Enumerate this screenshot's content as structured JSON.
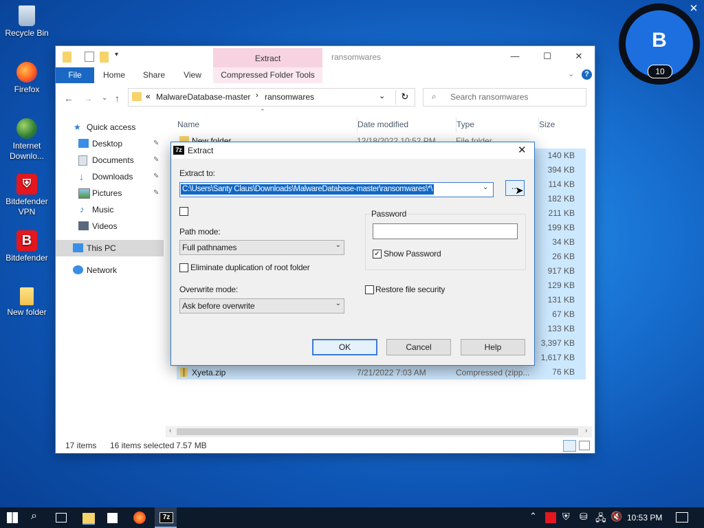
{
  "desktop": {
    "icons": [
      {
        "label": "Recycle Bin"
      },
      {
        "label": "Firefox"
      },
      {
        "label": "Internet Downlo..."
      },
      {
        "label": "Bitdefender VPN"
      },
      {
        "label": "Bitdefender"
      },
      {
        "label": "New folder"
      }
    ]
  },
  "notification_widget": {
    "letter": "B",
    "count": "10",
    "color": "#1d6fe0"
  },
  "explorer": {
    "title": "ransomwares",
    "contextual_tab_group": "Extract",
    "ribbon_tabs": [
      "File",
      "Home",
      "Share",
      "View",
      "Compressed Folder Tools"
    ],
    "breadcrumb": {
      "chevron": "«",
      "parts": [
        "MalwareDatabase-master",
        "ransomwares"
      ]
    },
    "search_placeholder": "Search ransomwares",
    "nav": {
      "quick_access": "Quick access",
      "items": [
        "Desktop",
        "Documents",
        "Downloads",
        "Pictures",
        "Music",
        "Videos"
      ],
      "this_pc": "This PC",
      "network": "Network"
    },
    "columns": [
      "Name",
      "Date modified",
      "Type",
      "Size"
    ],
    "first_row": {
      "name": "New folder",
      "date": "12/18/2022 10:52 PM",
      "type": "File folder"
    },
    "sizes": [
      "140 KB",
      "394 KB",
      "114 KB",
      "182 KB",
      "211 KB",
      "199 KB",
      "34 KB",
      "26 KB",
      "917 KB",
      "129 KB",
      "131 KB",
      "67 KB",
      "133 KB",
      "3,397 KB",
      "1,617 KB"
    ],
    "last_row": {
      "name": "Xyeta.zip",
      "date": "7/21/2022 7:03 AM",
      "type": "Compressed (zipp...",
      "size": "76 KB"
    },
    "status": {
      "items": "17 items",
      "selected": "16 items selected",
      "size": "7.57 MB"
    }
  },
  "dialog": {
    "app_badge": "7z",
    "title": "Extract",
    "extract_to_label": "Extract to:",
    "extract_to_value": "C:\\Users\\Santy Claus\\Downloads\\MalwareDatabase-master\\ransomwares\\*\\",
    "browse_label": "...",
    "path_mode_label": "Path mode:",
    "path_mode_value": "Full pathnames",
    "eliminate_dup_label": "Eliminate duplication of root folder",
    "overwrite_mode_label": "Overwrite mode:",
    "overwrite_mode_value": "Ask before overwrite",
    "password_group_label": "Password",
    "show_password_label": "Show Password",
    "restore_security_label": "Restore file security",
    "ok_label": "OK",
    "cancel_label": "Cancel",
    "help_label": "Help"
  },
  "taskbar": {
    "time": "10:53 PM"
  }
}
